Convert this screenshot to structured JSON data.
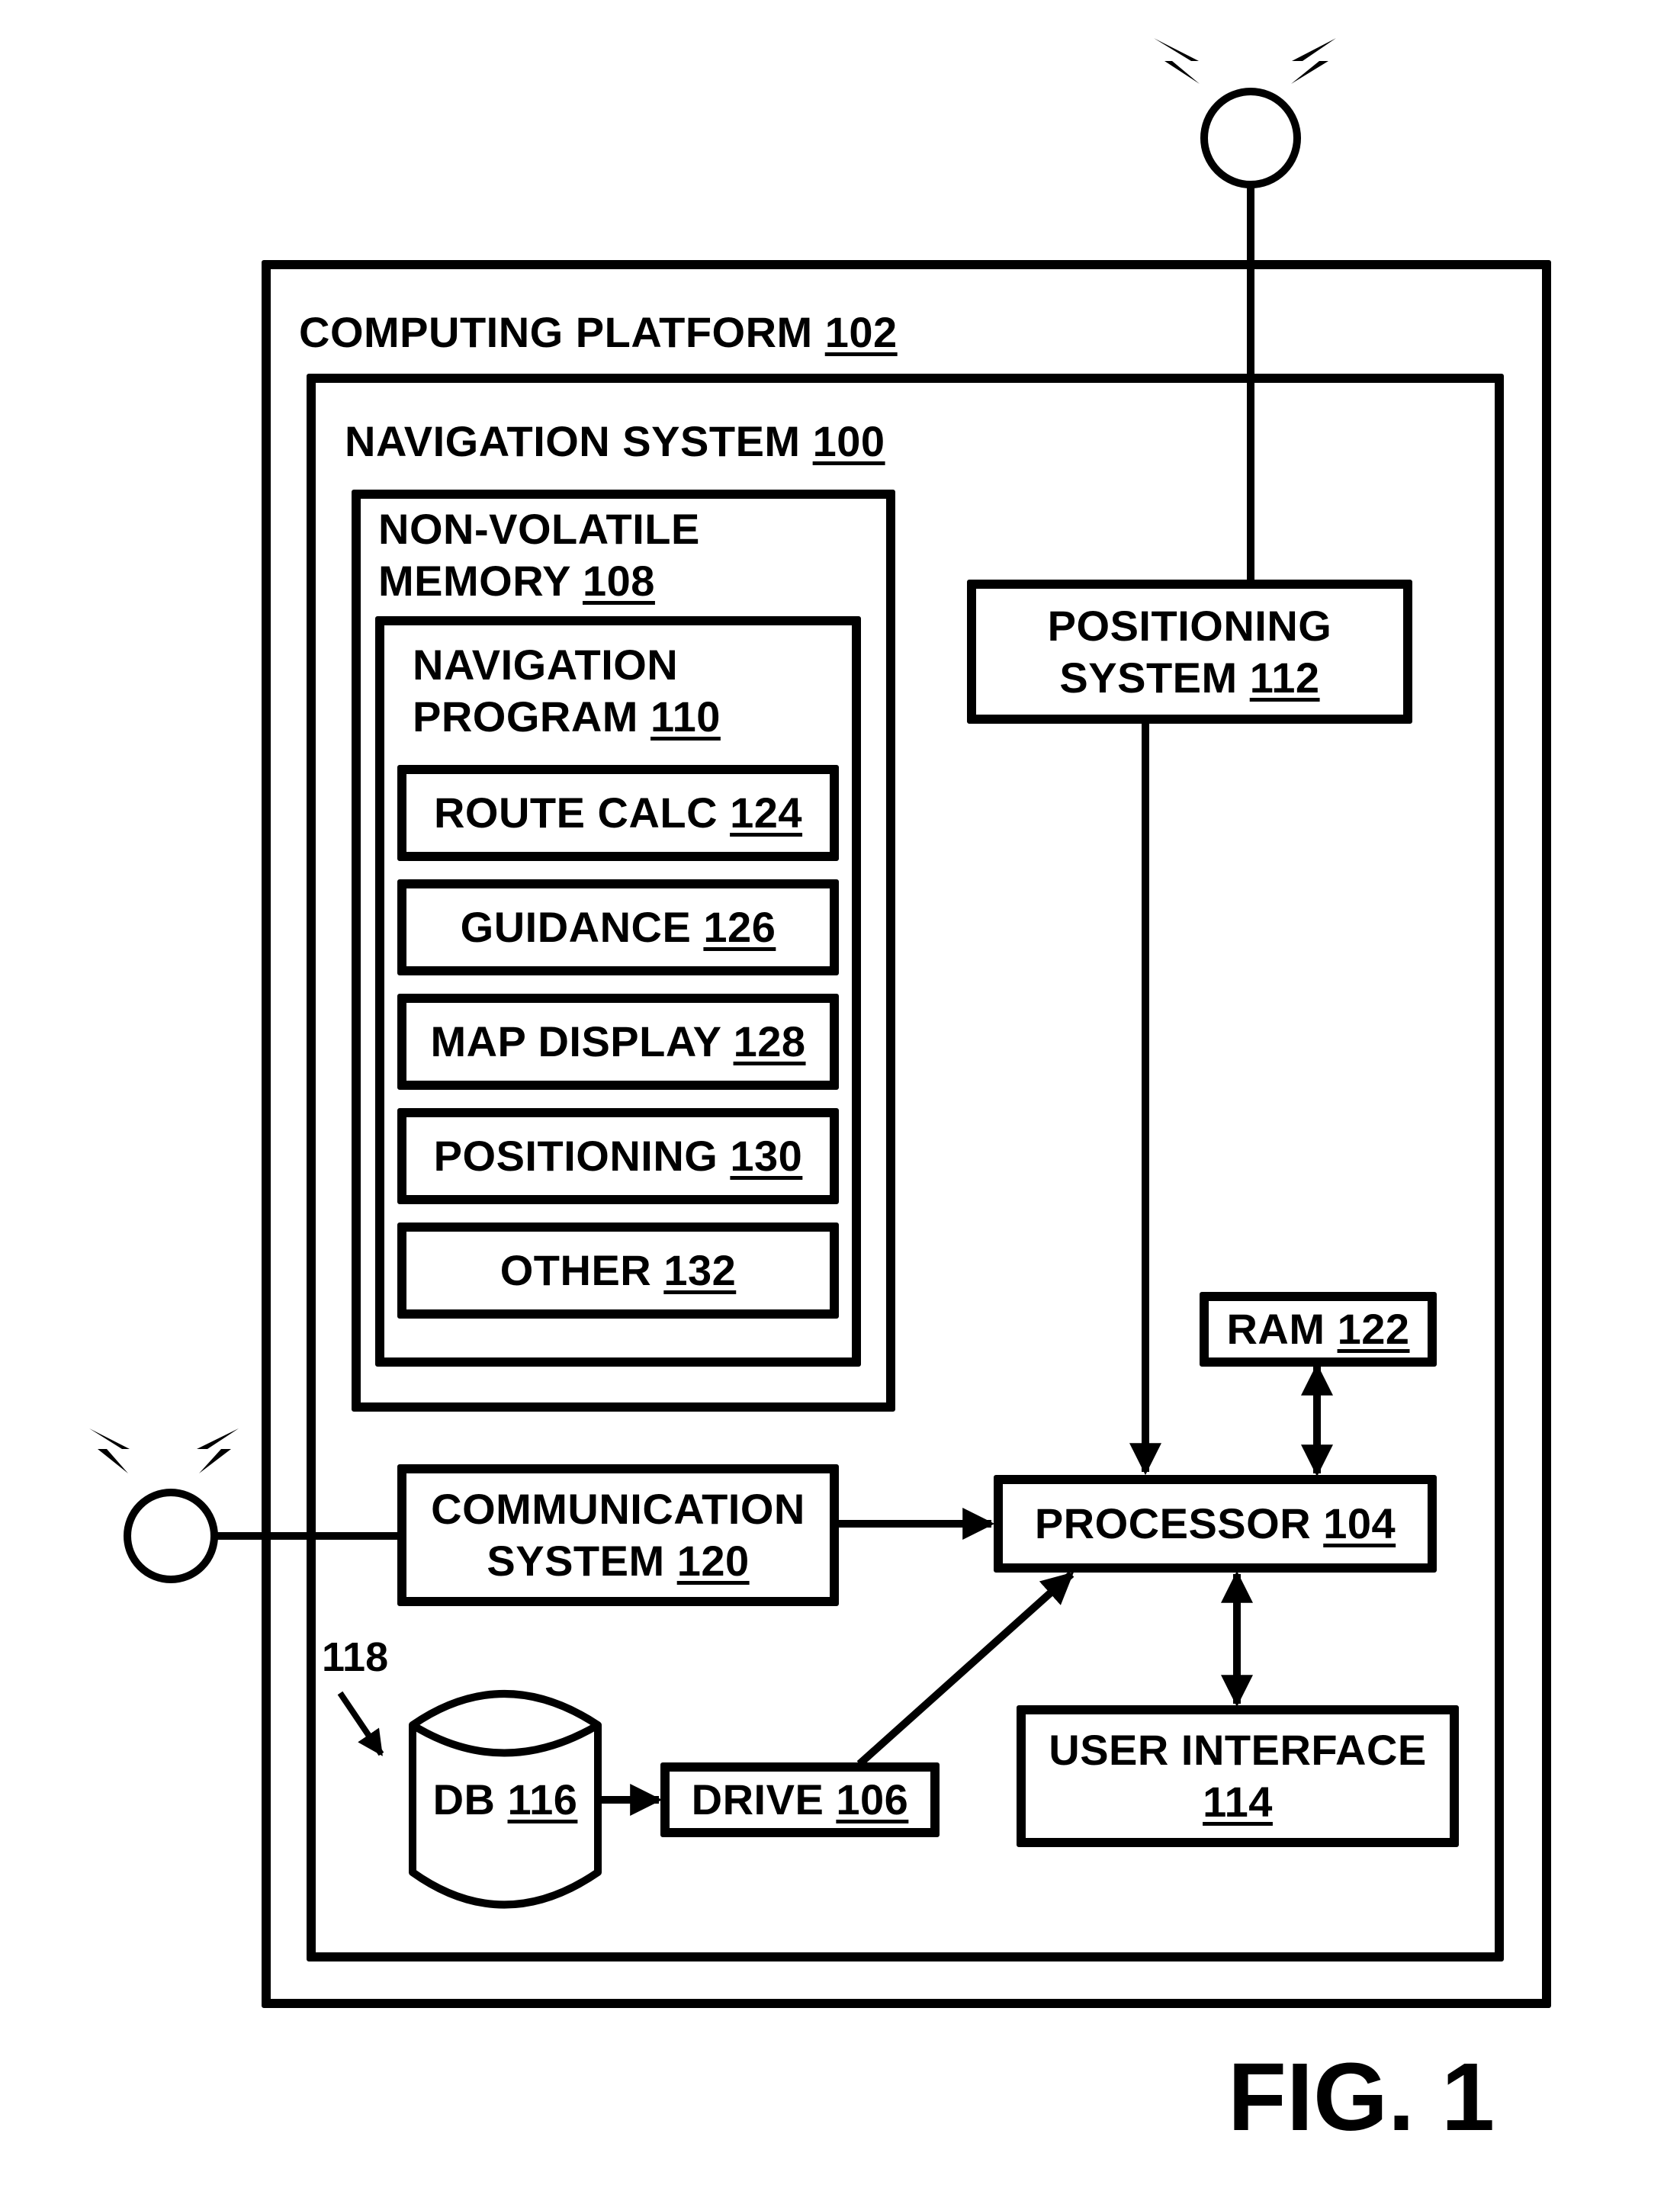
{
  "figure": {
    "label": "FIG. 1"
  },
  "computing_platform": {
    "name": "COMPUTING PLATFORM",
    "ref": "102"
  },
  "navigation_system": {
    "name": "NAVIGATION SYSTEM",
    "ref": "100"
  },
  "non_volatile_memory": {
    "line1": "NON-VOLATILE",
    "line2": "MEMORY",
    "ref": "108"
  },
  "navigation_program": {
    "line1": "NAVIGATION",
    "line2": "PROGRAM",
    "ref": "110",
    "modules": [
      {
        "name": "ROUTE CALC",
        "ref": "124"
      },
      {
        "name": "GUIDANCE",
        "ref": "126"
      },
      {
        "name": "MAP DISPLAY",
        "ref": "128"
      },
      {
        "name": "POSITIONING",
        "ref": "130"
      },
      {
        "name": "OTHER",
        "ref": "132"
      }
    ]
  },
  "positioning_system": {
    "line1": "POSITIONING",
    "line2": "SYSTEM",
    "ref": "112"
  },
  "ram": {
    "name": "RAM",
    "ref": "122"
  },
  "processor": {
    "name": "PROCESSOR",
    "ref": "104"
  },
  "communication_system": {
    "line1": "COMMUNICATION",
    "line2": "SYSTEM",
    "ref": "120"
  },
  "user_interface": {
    "line1": "USER INTERFACE",
    "ref": "114"
  },
  "database": {
    "name": "DB",
    "ref": "116",
    "callout": "118"
  },
  "drive": {
    "name": "DRIVE",
    "ref": "106"
  },
  "connections": [
    {
      "from": "positioning_antenna",
      "to": "positioning_system",
      "type": "line"
    },
    {
      "from": "positioning_system",
      "to": "processor",
      "type": "arrow"
    },
    {
      "from": "ram",
      "to": "processor",
      "type": "bidirectional"
    },
    {
      "from": "communication_antenna",
      "to": "communication_system",
      "type": "line"
    },
    {
      "from": "communication_system",
      "to": "processor",
      "type": "arrow"
    },
    {
      "from": "database",
      "to": "drive",
      "type": "arrow"
    },
    {
      "from": "drive",
      "to": "processor",
      "type": "arrow"
    },
    {
      "from": "processor",
      "to": "user_interface",
      "type": "bidirectional"
    }
  ]
}
